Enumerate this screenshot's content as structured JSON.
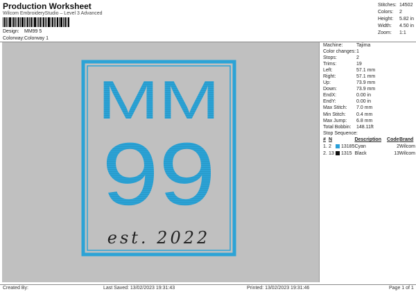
{
  "header": {
    "title": "Production Worksheet",
    "subtitle": "Wilcom EmbroideryStudio – Level 3 Advanced"
  },
  "design_meta": {
    "design_label": "Design:",
    "design_value": "MM99 5",
    "colorway_label": "Colorway:",
    "colorway_value": "Colorway 1"
  },
  "summary": {
    "stitches_label": "Stitches:",
    "stitches_value": "14502",
    "colors_label": "Colors:",
    "colors_value": "2",
    "height_label": "Height:",
    "height_value": "5.82 in",
    "width_label": "Width:",
    "width_value": "4.50 in",
    "zoom_label": "Zoom:",
    "zoom_value": "1:1"
  },
  "info": [
    {
      "k": "Machine:",
      "v": "Tajima"
    },
    {
      "k": "Color changes:",
      "v": "1"
    },
    {
      "k": "Stops:",
      "v": "2"
    },
    {
      "k": "Trims:",
      "v": "19"
    },
    {
      "k": "Left:",
      "v": "57.1 mm"
    },
    {
      "k": "Right:",
      "v": "57.1 mm"
    },
    {
      "k": "Up:",
      "v": "73.9 mm"
    },
    {
      "k": "Down:",
      "v": "73.9 mm"
    },
    {
      "k": "EndX:",
      "v": "0.00 in"
    },
    {
      "k": "EndY:",
      "v": "0.00 in"
    },
    {
      "k": "Max Stitch:",
      "v": "7.0 mm"
    },
    {
      "k": "Min Stitch:",
      "v": "0.4 mm"
    },
    {
      "k": "Max Jump:",
      "v": "6.8 mm"
    },
    {
      "k": "Total Bobbin:",
      "v": "148.11ft"
    }
  ],
  "stop_sequence": {
    "title": "Stop Sequence:",
    "headers": [
      "#",
      "N",
      "",
      "Description",
      "Code",
      "Brand"
    ],
    "rows": [
      {
        "num": "1.",
        "n": "2",
        "swatch": "#2a9fd8",
        "id": "13185",
        "desc": "Cyan",
        "code": "2",
        "brand": "Wilcom"
      },
      {
        "num": "2.",
        "n": "13",
        "swatch": "#111111",
        "id": "1315",
        "desc": "Black",
        "code": "13",
        "brand": "Wilcom"
      }
    ]
  },
  "artwork": {
    "line1": "MM",
    "line2": "99",
    "script": "est. 2022",
    "frame_color": "#2ca3d6",
    "text_color": "#2ca3d6",
    "script_color": "#222222",
    "background": "#c0c0c0"
  },
  "footer": {
    "created_by": "Created By:",
    "last_saved": "Last Saved: 13/02/2023 19:31:43",
    "printed": "Printed: 13/02/2023 19:31:46",
    "page": "Page 1 of 1"
  }
}
